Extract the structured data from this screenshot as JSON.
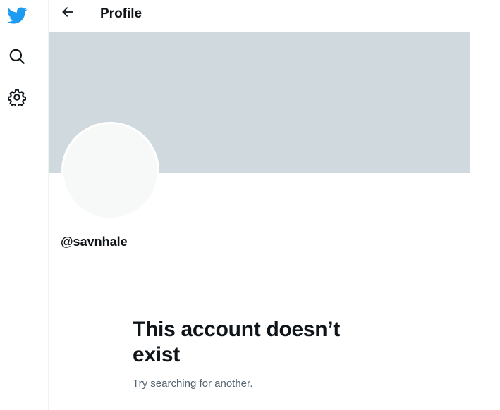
{
  "sidebar": {
    "items": [
      {
        "icon": "twitter-bird-icon",
        "color": "#1d9bf0"
      },
      {
        "icon": "search-icon"
      },
      {
        "icon": "gear-icon"
      }
    ]
  },
  "header": {
    "back_icon": "arrow-left-icon",
    "title": "Profile"
  },
  "profile": {
    "handle": "@savnhale",
    "banner_color": "#cfd9de"
  },
  "empty_state": {
    "title": "This account doesn’t exist",
    "subtitle": "Try searching for another."
  }
}
